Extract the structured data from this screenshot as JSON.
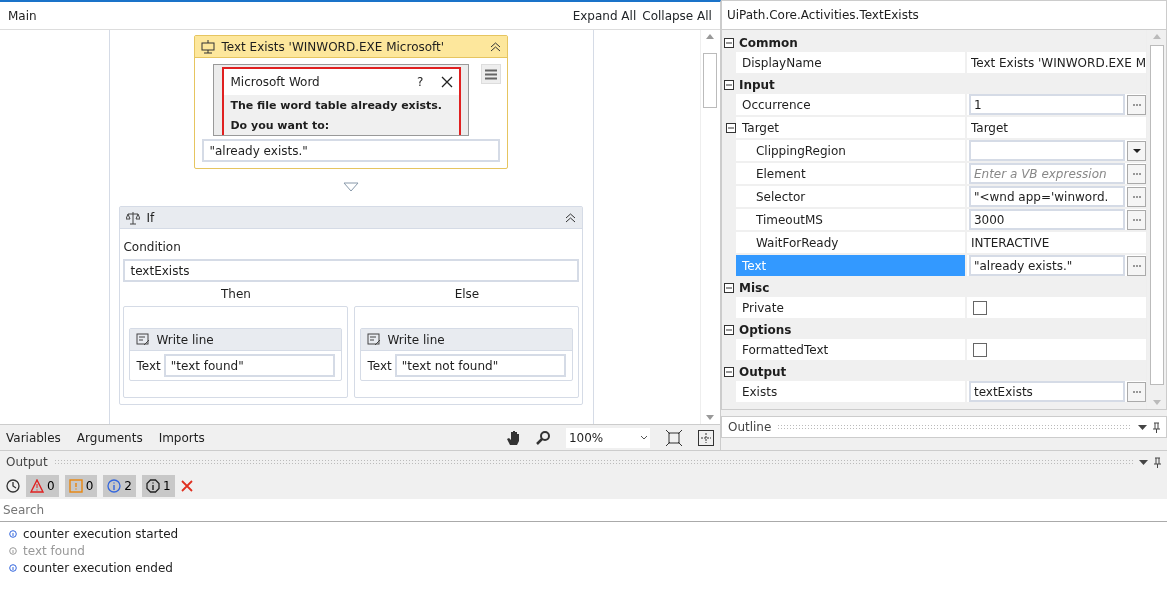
{
  "designer": {
    "breadcrumb": "Main",
    "expand_all": "Expand All",
    "collapse_all": "Collapse All",
    "text_exists": {
      "title": "Text Exists 'WINWORD.EXE Microsoft'",
      "preview": {
        "title": "Microsoft Word",
        "help": "?",
        "message": "The file word table already exists.",
        "next_line": "Do you want to:"
      },
      "text_value": "\"already exists.\""
    },
    "if_activity": {
      "title": "If",
      "condition_label": "Condition",
      "condition": "textExists",
      "branches": [
        {
          "label": "Then",
          "activity": {
            "title": "Write line",
            "field_label": "Text",
            "value": "\"text found\""
          }
        },
        {
          "label": "Else",
          "activity": {
            "title": "Write line",
            "field_label": "Text",
            "value": "\"text not found\""
          }
        }
      ]
    },
    "bottom_tabs": [
      "Variables",
      "Arguments",
      "Imports"
    ],
    "zoom": "100%"
  },
  "properties": {
    "title": "UiPath.Core.Activities.TextExists",
    "categories": [
      {
        "name": "Common",
        "expanded": true,
        "rows": [
          {
            "name": "DisplayName",
            "kind": "text",
            "value": "Text Exists 'WINWORD.EXE M",
            "selected": false
          }
        ]
      },
      {
        "name": "Input",
        "expanded": true,
        "rows": [
          {
            "name": "Occurrence",
            "kind": "field",
            "value": "1",
            "selected": false
          },
          {
            "name": "Target",
            "kind": "group",
            "value": "Target",
            "expanded": true,
            "selected": false,
            "children": [
              {
                "name": "ClippingRegion",
                "kind": "dropdown",
                "selected": false
              },
              {
                "name": "Element",
                "kind": "field",
                "placeholder": "Enter a VB expression",
                "selected": false
              },
              {
                "name": "Selector",
                "kind": "field",
                "value": "\"<wnd app='winword.",
                "selected": false
              },
              {
                "name": "TimeoutMS",
                "kind": "field",
                "value": "3000",
                "selected": false
              },
              {
                "name": "WaitForReady",
                "kind": "text",
                "value": "INTERACTIVE",
                "selected": false
              }
            ]
          },
          {
            "name": "Text",
            "kind": "field",
            "value": "\"already exists.\"",
            "selected": true
          }
        ]
      },
      {
        "name": "Misc",
        "expanded": true,
        "rows": [
          {
            "name": "Private",
            "kind": "checkbox",
            "checked": false,
            "selected": false
          }
        ]
      },
      {
        "name": "Options",
        "expanded": true,
        "rows": [
          {
            "name": "FormattedText",
            "kind": "checkbox",
            "checked": false,
            "selected": false
          }
        ]
      },
      {
        "name": "Output",
        "expanded": true,
        "rows": [
          {
            "name": "Exists",
            "kind": "field",
            "value": "textExists",
            "selected": false
          }
        ]
      }
    ]
  },
  "outline": {
    "title": "Outline"
  },
  "output": {
    "title": "Output",
    "filters": [
      {
        "kind": "error",
        "count": "0"
      },
      {
        "kind": "warning",
        "count": "0"
      },
      {
        "kind": "info",
        "count": "2"
      },
      {
        "kind": "trace",
        "count": "1"
      }
    ],
    "search_placeholder": "Search",
    "messages": [
      {
        "kind": "info",
        "text": "counter execution started"
      },
      {
        "kind": "trace",
        "text": "text found"
      },
      {
        "kind": "info",
        "text": "counter execution ended"
      }
    ]
  }
}
